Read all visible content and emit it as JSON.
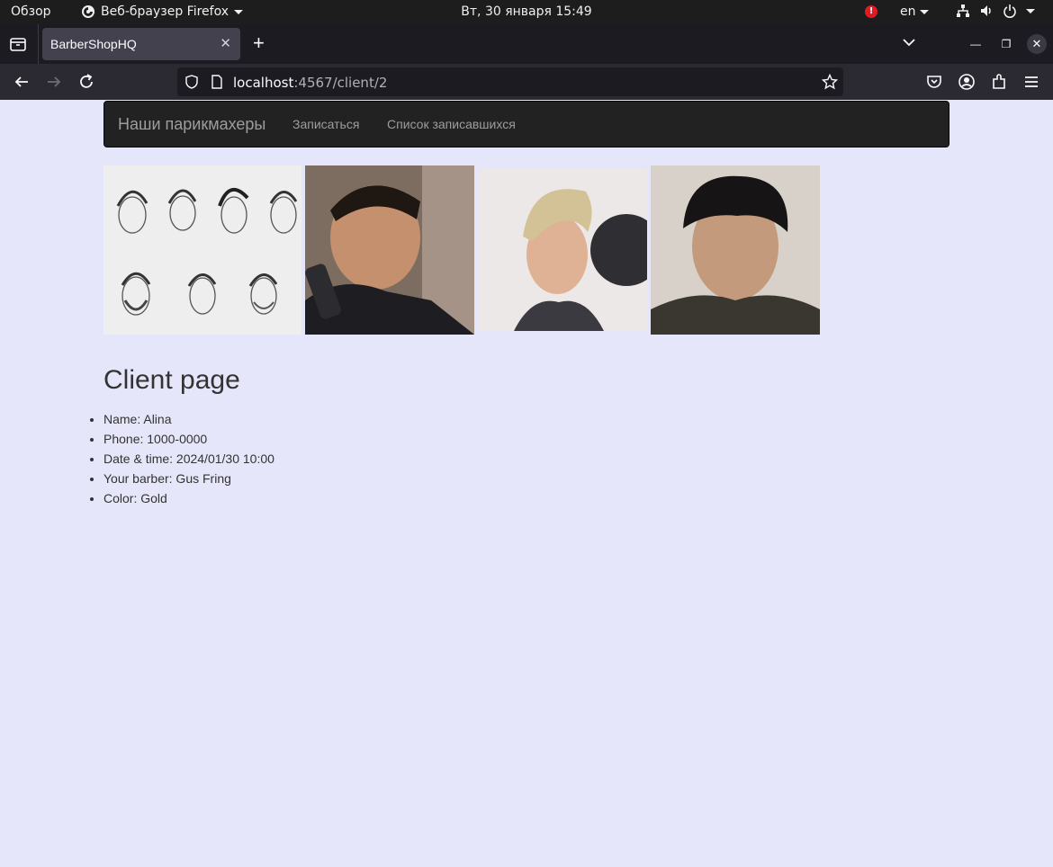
{
  "system_bar": {
    "overview": "Обзор",
    "app_menu": "Веб-браузер Firefox",
    "clock": "Вт, 30 января  15:49",
    "alert": "!",
    "language": "en"
  },
  "browser": {
    "tab_title": "BarberShopHQ",
    "url_host": "localhost",
    "url_path": ":4567/client/2"
  },
  "site_nav": {
    "brand": "Наши парикмахеры",
    "links": [
      "Записаться",
      "Список записавшихся"
    ]
  },
  "gallery": [
    "hairstyles-sketch",
    "fade-haircut",
    "swept-blond-haircut",
    "fringe-haircut"
  ],
  "client": {
    "heading": "Client page",
    "fields": [
      "Name: Alina",
      "Phone: 1000-0000",
      "Date & time: 2024/01/30 10:00",
      "Your barber: Gus Fring",
      "Color: Gold"
    ]
  },
  "colors": {
    "page_background": "#e6e6fa",
    "navbar": "#222222",
    "alert": "#e01b24"
  }
}
